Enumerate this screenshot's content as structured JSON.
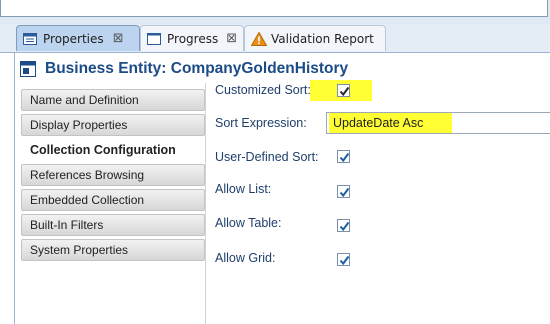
{
  "tabs": [
    {
      "label": "Properties",
      "icon": "properties-icon",
      "active": true
    },
    {
      "label": "Progress",
      "icon": "progress-icon",
      "active": false
    },
    {
      "label": "Validation Report",
      "icon": "warning-icon",
      "active": false
    }
  ],
  "entity": {
    "title": "Business Entity: CompanyGoldenHistory",
    "icon": "business-entity-icon"
  },
  "nav": {
    "items": [
      {
        "label": "Name and Definition",
        "selected": false
      },
      {
        "label": "Display Properties",
        "selected": false
      },
      {
        "label": "Collection Configuration",
        "selected": true
      },
      {
        "label": "References Browsing",
        "selected": false
      },
      {
        "label": "Embedded Collection",
        "selected": false
      },
      {
        "label": "Built-In Filters",
        "selected": false
      },
      {
        "label": "System Properties",
        "selected": false
      }
    ]
  },
  "form": {
    "customized_sort": {
      "label": "Customized Sort:",
      "checked": true
    },
    "sort_expression": {
      "label": "Sort Expression:",
      "value": "UpdateDate Asc"
    },
    "user_defined_sort": {
      "label": "User-Defined Sort:",
      "checked": true
    },
    "allow_list": {
      "label": "Allow List:",
      "checked": true
    },
    "allow_table": {
      "label": "Allow Table:",
      "checked": true
    },
    "allow_grid": {
      "label": "Allow Grid:",
      "checked": true
    }
  },
  "colors": {
    "highlight": "#ffff33",
    "title": "#1c4b87",
    "active_tab": "#bcd4ef"
  }
}
